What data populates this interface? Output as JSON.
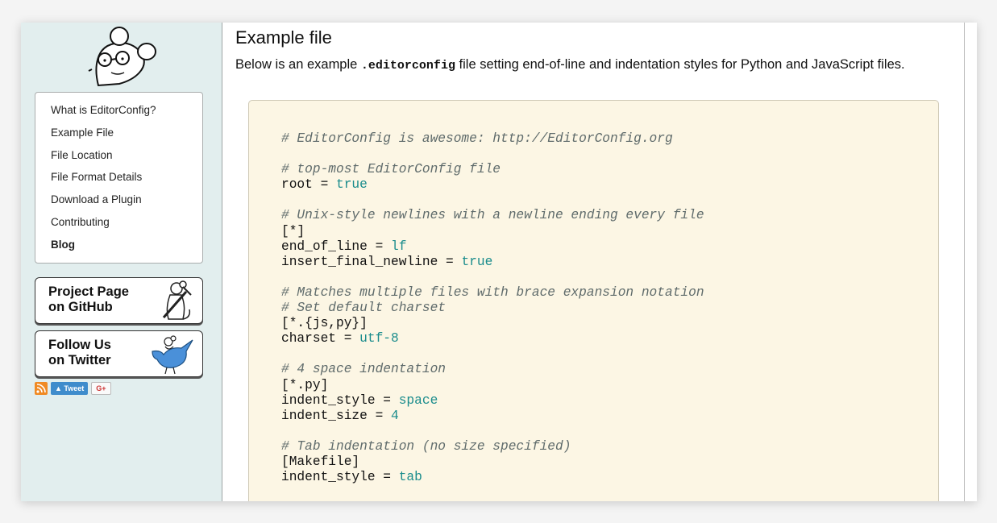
{
  "sidebar": {
    "nav": [
      {
        "label": "What is EditorConfig?",
        "bold": false
      },
      {
        "label": "Example File",
        "bold": false
      },
      {
        "label": "File Location",
        "bold": false
      },
      {
        "label": "File Format Details",
        "bold": false
      },
      {
        "label": "Download a Plugin",
        "bold": false
      },
      {
        "label": "Contributing",
        "bold": false
      },
      {
        "label": "Blog",
        "bold": true
      }
    ],
    "github": {
      "line1": "Project Page",
      "line2": "on GitHub"
    },
    "twitter": {
      "line1": "Follow Us",
      "line2": "on Twitter"
    },
    "social": {
      "tweet_label": "Tweet",
      "gplus_label": "G+"
    }
  },
  "main": {
    "title": "Example file",
    "intro_before": "Below is an example ",
    "intro_code": ".editorconfig",
    "intro_after": " file setting end-of-line and indentation styles for Python and JavaScript files."
  },
  "code": {
    "lines": [
      {
        "type": "comment",
        "text": "# EditorConfig is awesome: http://EditorConfig.org"
      },
      {
        "type": "blank",
        "text": ""
      },
      {
        "type": "comment",
        "text": "# top-most EditorConfig file"
      },
      {
        "type": "kv",
        "key": "root = ",
        "value": "true"
      },
      {
        "type": "blank",
        "text": ""
      },
      {
        "type": "comment",
        "text": "# Unix-style newlines with a newline ending every file"
      },
      {
        "type": "plain",
        "text": "[*]"
      },
      {
        "type": "kv",
        "key": "end_of_line = ",
        "value": "lf"
      },
      {
        "type": "kv",
        "key": "insert_final_newline = ",
        "value": "true"
      },
      {
        "type": "blank",
        "text": ""
      },
      {
        "type": "comment",
        "text": "# Matches multiple files with brace expansion notation"
      },
      {
        "type": "comment",
        "text": "# Set default charset"
      },
      {
        "type": "plain",
        "text": "[*.{js,py}]"
      },
      {
        "type": "kv",
        "key": "charset = ",
        "value": "utf-8"
      },
      {
        "type": "blank",
        "text": ""
      },
      {
        "type": "comment",
        "text": "# 4 space indentation"
      },
      {
        "type": "plain",
        "text": "[*.py]"
      },
      {
        "type": "kv",
        "key": "indent_style = ",
        "value": "space"
      },
      {
        "type": "kv",
        "key": "indent_size = ",
        "value": "4"
      },
      {
        "type": "blank",
        "text": ""
      },
      {
        "type": "comment",
        "text": "# Tab indentation (no size specified)"
      },
      {
        "type": "plain",
        "text": "[Makefile]"
      },
      {
        "type": "kv",
        "key": "indent_style = ",
        "value": "tab"
      }
    ]
  },
  "colors": {
    "sidebar_bg": "#e2eeee",
    "code_bg": "#fcf6e4",
    "code_value": "#1a8c8c",
    "code_comment": "#5f6b6b"
  },
  "icons": [
    "mouse-logo-icon",
    "github-mouse-icon",
    "twitter-bird-icon",
    "rss-icon"
  ]
}
